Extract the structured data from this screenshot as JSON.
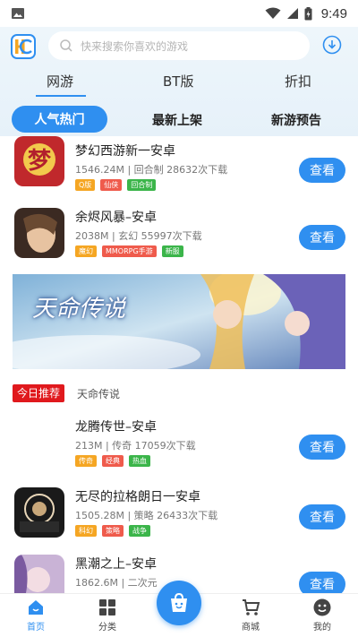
{
  "status_bar": {
    "time": "9:49"
  },
  "search": {
    "placeholder": "快来搜索你喜欢的游戏"
  },
  "top_tabs": [
    {
      "label": "网游",
      "active": true
    },
    {
      "label": "BT版",
      "active": false
    },
    {
      "label": "折扣",
      "active": false
    }
  ],
  "sub_tabs": [
    {
      "label": "人气热门",
      "active": true
    },
    {
      "label": "最新上架",
      "active": false
    },
    {
      "label": "新游预告",
      "active": false
    }
  ],
  "games": [
    {
      "name": "梦幻西游新一安卓",
      "meta": "1546.24M | 回合制  28632次下载",
      "tags": [
        {
          "label": "Q版",
          "color": "#f5a623"
        },
        {
          "label": "仙侠",
          "color": "#ef5b4c"
        },
        {
          "label": "回合制",
          "color": "#3bb54a"
        }
      ],
      "button": "查看"
    },
    {
      "name": "余烬风暴–安卓",
      "meta": "2038M | 玄幻  55997次下载",
      "tags": [
        {
          "label": "魔幻",
          "color": "#f5a623"
        },
        {
          "label": "MMORPG手游",
          "color": "#ef5b4c"
        },
        {
          "label": "新服",
          "color": "#3bb54a"
        }
      ],
      "button": "查看"
    },
    {
      "name": "龙腾传世–安卓",
      "meta": "213M | 传奇  17059次下载",
      "tags": [
        {
          "label": "传奇",
          "color": "#f5a623"
        },
        {
          "label": "经典",
          "color": "#ef5b4c"
        },
        {
          "label": "热血",
          "color": "#3bb54a"
        }
      ],
      "button": "查看"
    },
    {
      "name": "无尽的拉格朗日一安卓",
      "meta": "1505.28M | 策略  26433次下载",
      "tags": [
        {
          "label": "科幻",
          "color": "#f5a623"
        },
        {
          "label": "策略",
          "color": "#ef5b4c"
        },
        {
          "label": "战争",
          "color": "#3bb54a"
        }
      ],
      "button": "查看"
    },
    {
      "name": "黑潮之上–安卓",
      "meta": "1862.6M | 二次元",
      "tags": [],
      "button": "查看"
    }
  ],
  "banner": {
    "title": "天命传说"
  },
  "today": {
    "badge": "今日推荐",
    "game": "天命传说"
  },
  "bottom_nav": [
    {
      "label": "首页",
      "icon": "home-icon",
      "active": true
    },
    {
      "label": "分类",
      "icon": "grid-icon",
      "active": false
    },
    {
      "label": "商城",
      "icon": "cart-icon",
      "active": false
    },
    {
      "label": "我的",
      "icon": "profile-icon",
      "active": false
    }
  ],
  "colors": {
    "accent": "#2f8ff0",
    "badge_red": "#e0191d"
  }
}
